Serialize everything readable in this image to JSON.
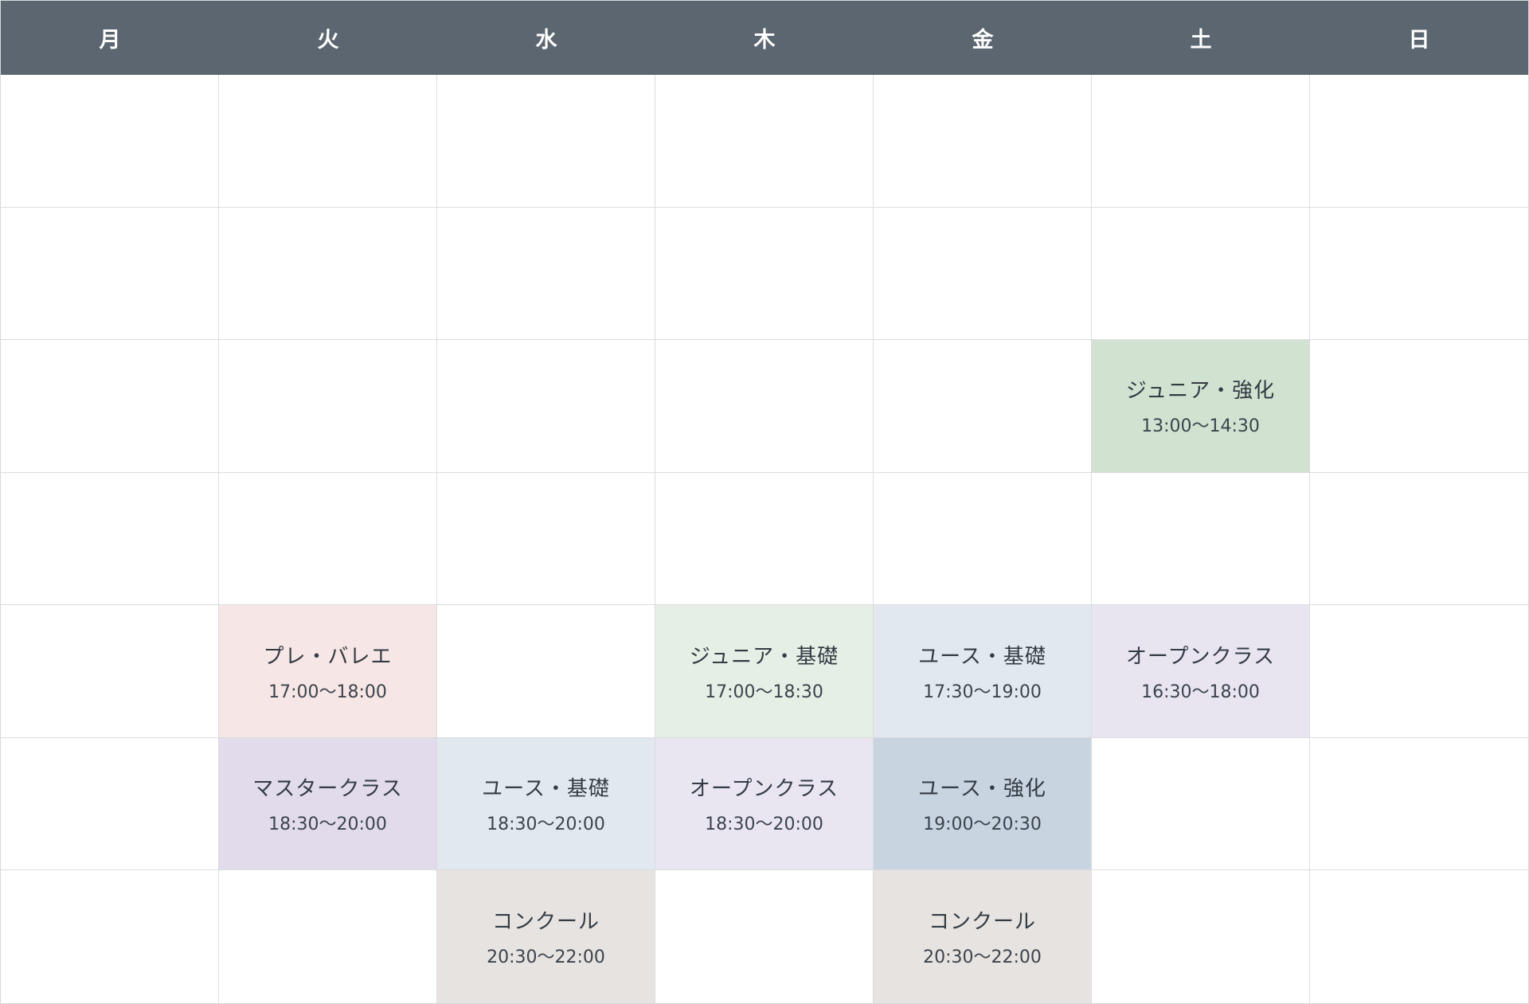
{
  "header": {
    "background": "#5b6670",
    "days": [
      "月",
      "火",
      "水",
      "木",
      "金",
      "土",
      "日"
    ]
  },
  "grid": {
    "rows": 7,
    "cols": 7
  },
  "classes": [
    {
      "name": "ジュニア・強化",
      "time": "13:00〜14:30",
      "row": 2,
      "col": 5,
      "color": "#d1e2d1"
    },
    {
      "name": "プレ・バレエ",
      "time": "17:00〜18:00",
      "row": 4,
      "col": 1,
      "color": "#f7e6e6"
    },
    {
      "name": "ジュニア・基礎",
      "time": "17:00〜18:30",
      "row": 4,
      "col": 3,
      "color": "#e6efe6"
    },
    {
      "name": "ユース・基礎",
      "time": "17:30〜19:00",
      "row": 4,
      "col": 4,
      "color": "#e2e8f0"
    },
    {
      "name": "オープンクラス",
      "time": "16:30〜18:00",
      "row": 4,
      "col": 5,
      "color": "#e8e4f0"
    },
    {
      "name": "マスタークラス",
      "time": "18:30〜20:00",
      "row": 5,
      "col": 1,
      "color": "#e1dbeb"
    },
    {
      "name": "ユース・基礎",
      "time": "18:30〜20:00",
      "row": 5,
      "col": 2,
      "color": "#e2e8f0"
    },
    {
      "name": "オープンクラス",
      "time": "18:30〜20:00",
      "row": 5,
      "col": 3,
      "color": "#e9e6f2"
    },
    {
      "name": "ユース・強化",
      "time": "19:00〜20:30",
      "row": 5,
      "col": 4,
      "color": "#c8d4e0"
    },
    {
      "name": "コンクール",
      "time": "20:30〜22:00",
      "row": 6,
      "col": 2,
      "color": "#e6e3e1"
    },
    {
      "name": "コンクール",
      "time": "20:30〜22:00",
      "row": 6,
      "col": 4,
      "color": "#e6e3e1"
    }
  ]
}
